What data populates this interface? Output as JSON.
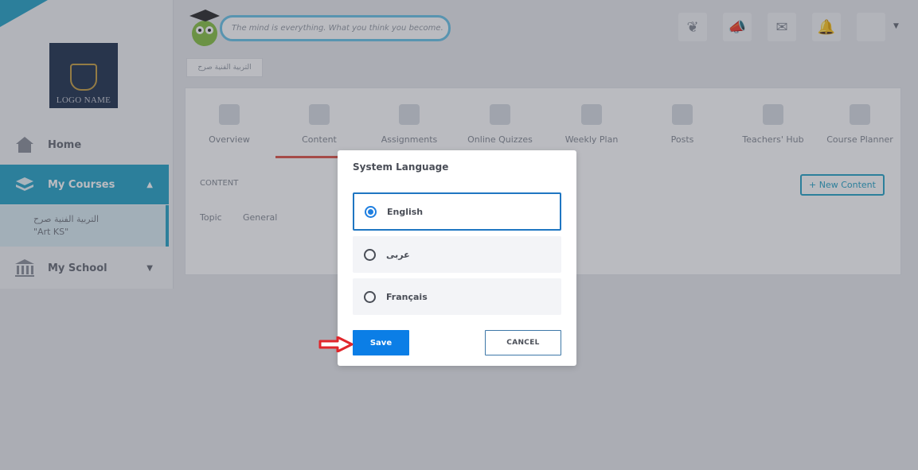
{
  "sidebar": {
    "logo_text": "LOGO NAME",
    "items": [
      {
        "label": "Home",
        "icon": "home-icon"
      },
      {
        "label": "My Courses",
        "icon": "book-icon"
      },
      {
        "label": "My School",
        "icon": "school-icon"
      }
    ],
    "submenu": {
      "line1": "التربية الفنية صرح",
      "line2": "\"Art KS\""
    }
  },
  "header": {
    "quote": "The mind is everything. What you think you become.",
    "icons": [
      "leaf-icon",
      "megaphone-icon",
      "mail-icon",
      "bell-icon"
    ]
  },
  "breadcrumb": "التربية الفنية صرح",
  "tabs": [
    "Overview",
    "Content",
    "Assignments",
    "Online Quizzes",
    "Weekly Plan",
    "Posts",
    "Teachers' Hub",
    "Course Planner"
  ],
  "content": {
    "label": "CONTENT",
    "new_button": "+ New Content",
    "topic_label": "Topic",
    "topic_value": "General"
  },
  "modal": {
    "title": "System Language",
    "options": [
      {
        "label": "English",
        "selected": true
      },
      {
        "label": "عربى",
        "selected": false
      },
      {
        "label": "Français",
        "selected": false
      }
    ],
    "save_label": "Save",
    "cancel_label": "CANCEL"
  },
  "colors": {
    "accent": "#0b7ee6",
    "selected_border": "#1f76c2",
    "sidebar_active": "#2fa7c9",
    "annotation_arrow": "#e0262b"
  }
}
